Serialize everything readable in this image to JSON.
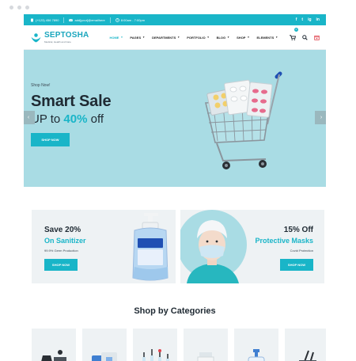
{
  "topbar": {
    "phone": "(+123) 456 7890",
    "email": "add[your]@emailhere",
    "hours": "8:00am - 7:00pm",
    "social": [
      "f",
      "t",
      "ig",
      "in"
    ]
  },
  "logo": {
    "name": "SEPTOSHA",
    "tagline": "Medical, Health and Care"
  },
  "nav": [
    {
      "label": "HOME",
      "active": true
    },
    {
      "label": "PAGES",
      "active": false
    },
    {
      "label": "DEPARTMENTS",
      "active": false
    },
    {
      "label": "PORTFOLIO",
      "active": false
    },
    {
      "label": "BLOG",
      "active": false
    },
    {
      "label": "SHOP",
      "active": false
    },
    {
      "label": "ELEMENTS",
      "active": false
    }
  ],
  "cart_count": "0",
  "hero": {
    "eyebrow": "Shop Now!",
    "title": "Smart Sale",
    "sub_prefix": "UP to ",
    "sub_highlight": "40%",
    "sub_suffix": " off",
    "button": "SHOP NOW",
    "prev": "‹",
    "next": "›"
  },
  "promos": [
    {
      "title": "Save 20%",
      "subtitle": "On Sanitizer",
      "note": "99.9% Germ Production",
      "button": "SHOP NOW"
    },
    {
      "title": "15% Off",
      "subtitle": "Protective Masks",
      "note": "Covid Protection",
      "button": "SHOP NOW"
    }
  ],
  "categories_title": "Shop by Categories",
  "colors": {
    "accent": "#19b5c8",
    "hero_bg": "#a9dce4",
    "text": "#1f2a33",
    "panel": "#eef2f4"
  },
  "icons": [
    "phone-icon",
    "mail-icon",
    "clock-icon",
    "facebook-icon",
    "twitter-icon",
    "instagram-icon",
    "linkedin-icon",
    "cart-icon",
    "search-icon",
    "calendar-icon"
  ]
}
